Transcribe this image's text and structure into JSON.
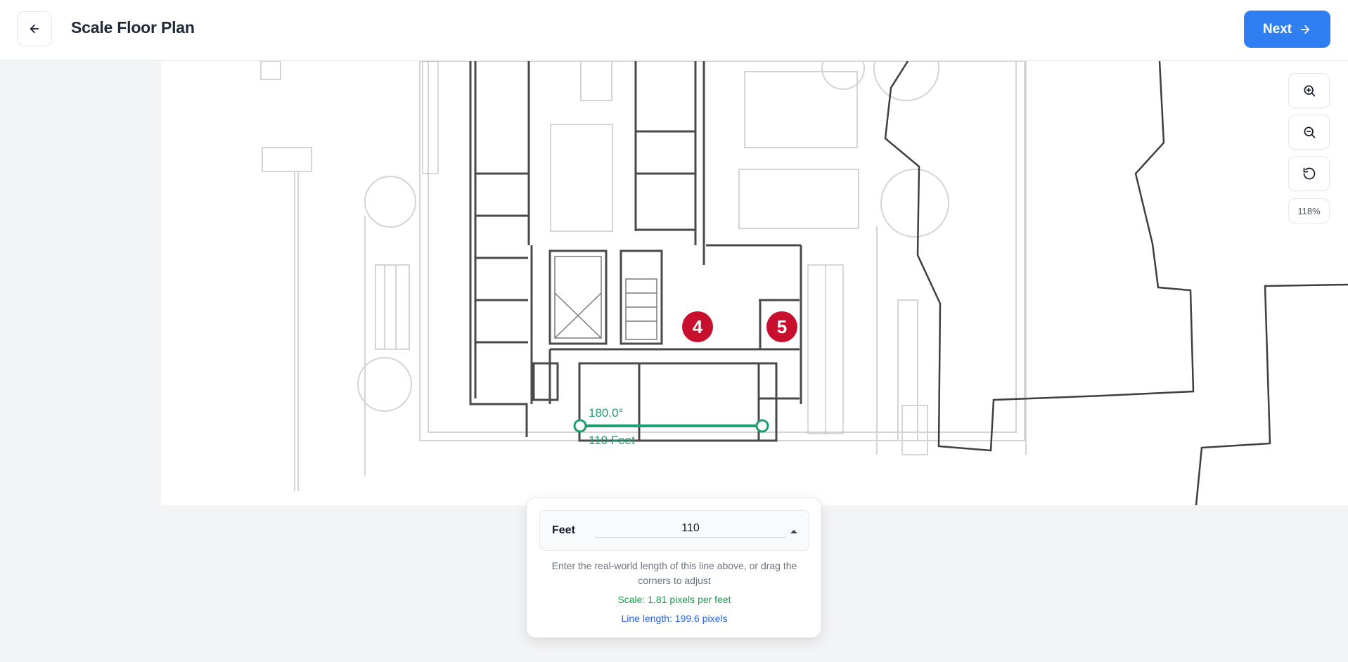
{
  "header": {
    "title": "Scale Floor Plan",
    "next_label": "Next"
  },
  "zoom": {
    "level": "118%"
  },
  "measure": {
    "angle_label": "180.0°",
    "length_label": "110 Feet",
    "line_color": "#1f9d6b"
  },
  "room_markers": [
    {
      "label": "4",
      "color": "#c8102e"
    },
    {
      "label": "5",
      "color": "#c8102e"
    }
  ],
  "panel": {
    "unit_label": "Feet",
    "length_value": "110",
    "help_text": "Enter the real-world length of this line above, or drag the corners to adjust",
    "scale_text": "Scale: 1.81 pixels per feet",
    "line_length_text": "Line length: 199.6 pixels"
  },
  "colors": {
    "accent": "#2f7ff2",
    "scale_green": "#16a34a",
    "length_blue": "#2563eb"
  }
}
